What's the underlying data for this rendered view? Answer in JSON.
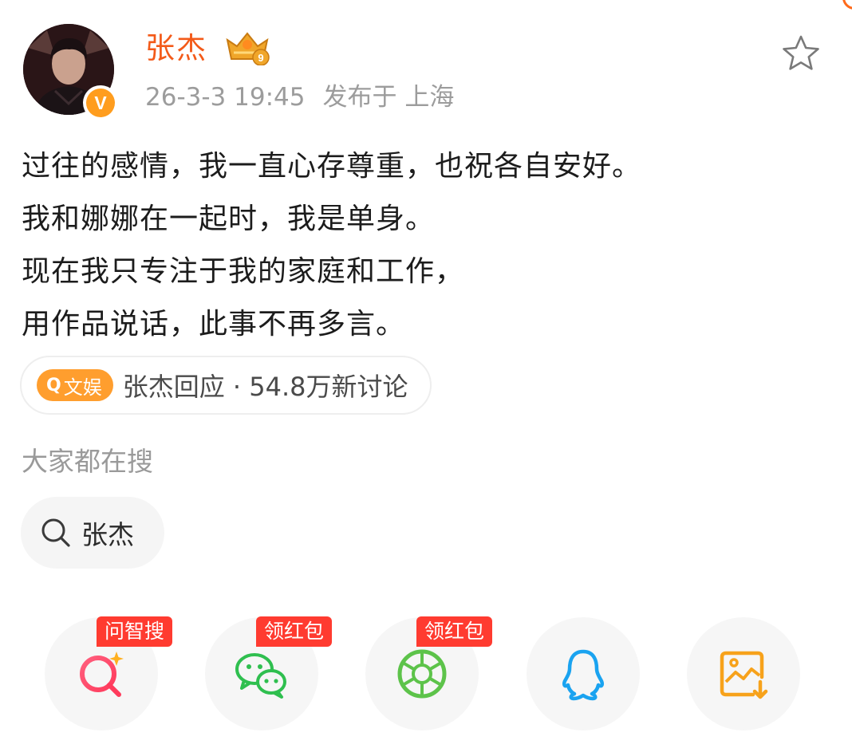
{
  "post": {
    "author": "张杰",
    "level": "9",
    "verified_mark": "V",
    "time": "26-3-3 19:45",
    "location_prefix": "发布于",
    "location": "上海",
    "lines": [
      "过往的感情，我一直心存尊重，也祝各自安好。",
      "我和娜娜在一起时，我是单身。",
      "现在我只专注于我的家庭和工作，",
      "用作品说话，此事不再多言。"
    ]
  },
  "topic": {
    "tag": "文娱",
    "text": "张杰回应 · 54.8万新讨论"
  },
  "search": {
    "title": "大家都在搜",
    "chip": "张杰"
  },
  "share": [
    {
      "badge": "问智搜",
      "icon": "ai-search-icon"
    },
    {
      "badge": "领红包",
      "icon": "wechat-icon"
    },
    {
      "badge": "领红包",
      "icon": "moments-icon"
    },
    {
      "badge": "",
      "icon": "qq-icon"
    },
    {
      "badge": "",
      "icon": "save-image-icon"
    }
  ],
  "colors": {
    "accent": "#f35a19",
    "badge_red": "#ff3b30",
    "topic_orange": "#ff9e2e"
  }
}
